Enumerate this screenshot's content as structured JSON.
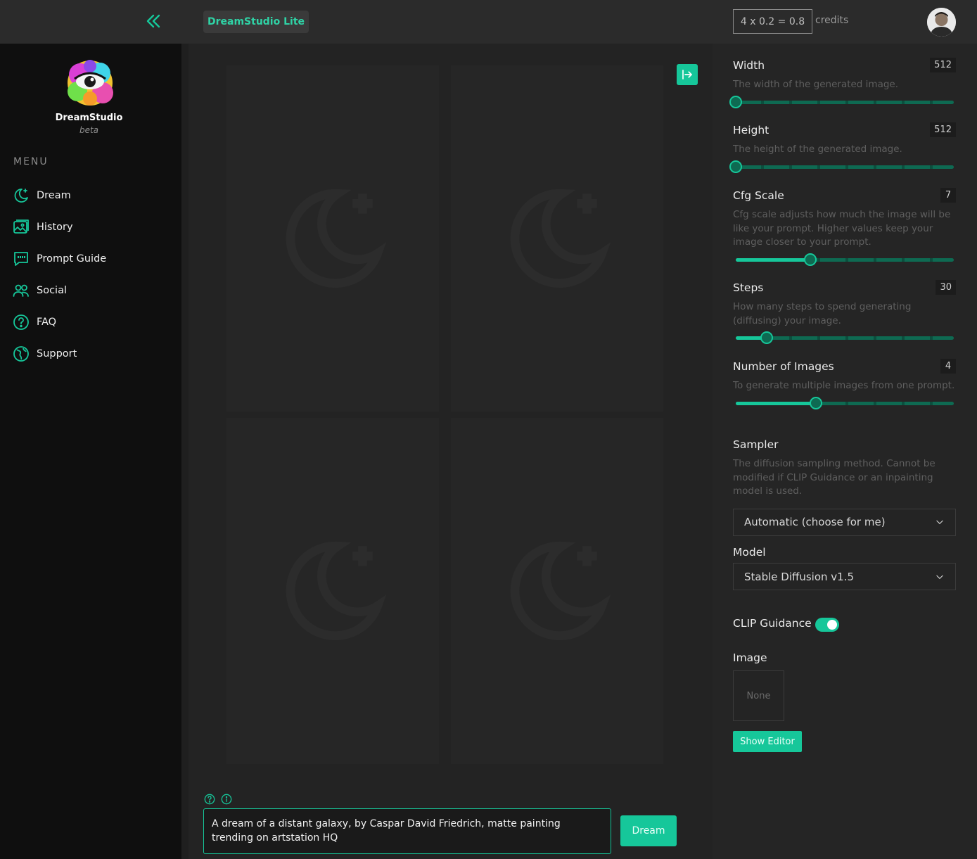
{
  "brand": {
    "name": "DreamStudio",
    "tag": "beta"
  },
  "header": {
    "lite_label": "DreamStudio Lite",
    "credits_formula": "4 x 0.2 = 0.8",
    "credits_label": "credits"
  },
  "menu": {
    "heading": "MENU",
    "items": [
      {
        "label": "Dream",
        "icon": "moon-sparkle-icon"
      },
      {
        "label": "History",
        "icon": "image-gallery-icon"
      },
      {
        "label": "Prompt Guide",
        "icon": "quote-bubble-icon"
      },
      {
        "label": "Social",
        "icon": "users-icon"
      },
      {
        "label": "FAQ",
        "icon": "question-circle-icon"
      },
      {
        "label": "Support",
        "icon": "globe-chat-icon"
      }
    ]
  },
  "prompt": {
    "text": "A dream of a distant galaxy, by Caspar David Friedrich, matte painting trending on artstation HQ",
    "dream_button": "Dream"
  },
  "settings": {
    "width": {
      "title": "Width",
      "value": "512",
      "desc": "The width of the generated image.",
      "fraction": 0.0
    },
    "height": {
      "title": "Height",
      "value": "512",
      "desc": "The height of the generated image.",
      "fraction": 0.0
    },
    "cfg": {
      "title": "Cfg Scale",
      "value": "7",
      "desc": "Cfg scale adjusts how much the image will be like your prompt. Higher values keep your image closer to your prompt.",
      "fraction": 0.35
    },
    "steps": {
      "title": "Steps",
      "value": "30",
      "desc": "How many steps to spend generating (diffusing) your image.",
      "fraction": 0.145
    },
    "images": {
      "title": "Number of Images",
      "value": "4",
      "desc": "To generate multiple images from one prompt.",
      "fraction": 0.375
    },
    "sampler": {
      "title": "Sampler",
      "desc": "The diffusion sampling method. Cannot be modified if CLIP Guidance or an inpainting model is used.",
      "selected": "Automatic (choose for me)"
    },
    "model": {
      "title": "Model",
      "selected": "Stable Diffusion v1.5"
    },
    "clip": {
      "title": "CLIP Guidance",
      "enabled": true
    },
    "image": {
      "title": "Image",
      "placeholder": "None",
      "editor_button": "Show Editor"
    }
  },
  "colors": {
    "accent": "#16c79a",
    "track": "#0e6a52",
    "sidebar": "#0f0f0f"
  }
}
